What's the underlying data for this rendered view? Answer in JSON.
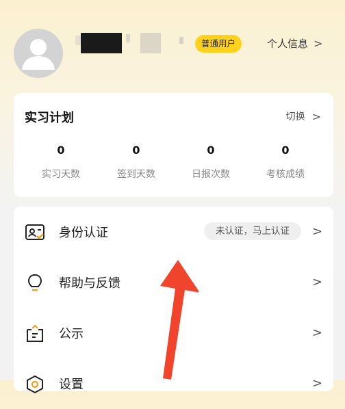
{
  "profile": {
    "badge": "普通用户",
    "link_label": "个人信息",
    "link_chevron": ">"
  },
  "plan": {
    "title": "实习计划",
    "switch_label": "切换",
    "switch_chevron": ">",
    "stats": [
      {
        "value": "0",
        "label": "实习天数"
      },
      {
        "value": "0",
        "label": "签到天数"
      },
      {
        "value": "0",
        "label": "日报次数"
      },
      {
        "value": "0",
        "label": "考核成绩"
      }
    ]
  },
  "menu": {
    "items": [
      {
        "label": "身份认证",
        "status": "未认证，马上认证",
        "icon": "id-card-icon",
        "chevron": ">"
      },
      {
        "label": "帮助与反馈",
        "icon": "lightbulb-icon",
        "chevron": ">"
      },
      {
        "label": "公示",
        "icon": "notice-icon",
        "chevron": ">"
      },
      {
        "label": "设置",
        "icon": "settings-icon",
        "chevron": ">"
      }
    ]
  },
  "colors": {
    "accent_yellow": "#fcd21c",
    "icon_orange": "#f0a020",
    "arrow_red": "#f0442c"
  }
}
